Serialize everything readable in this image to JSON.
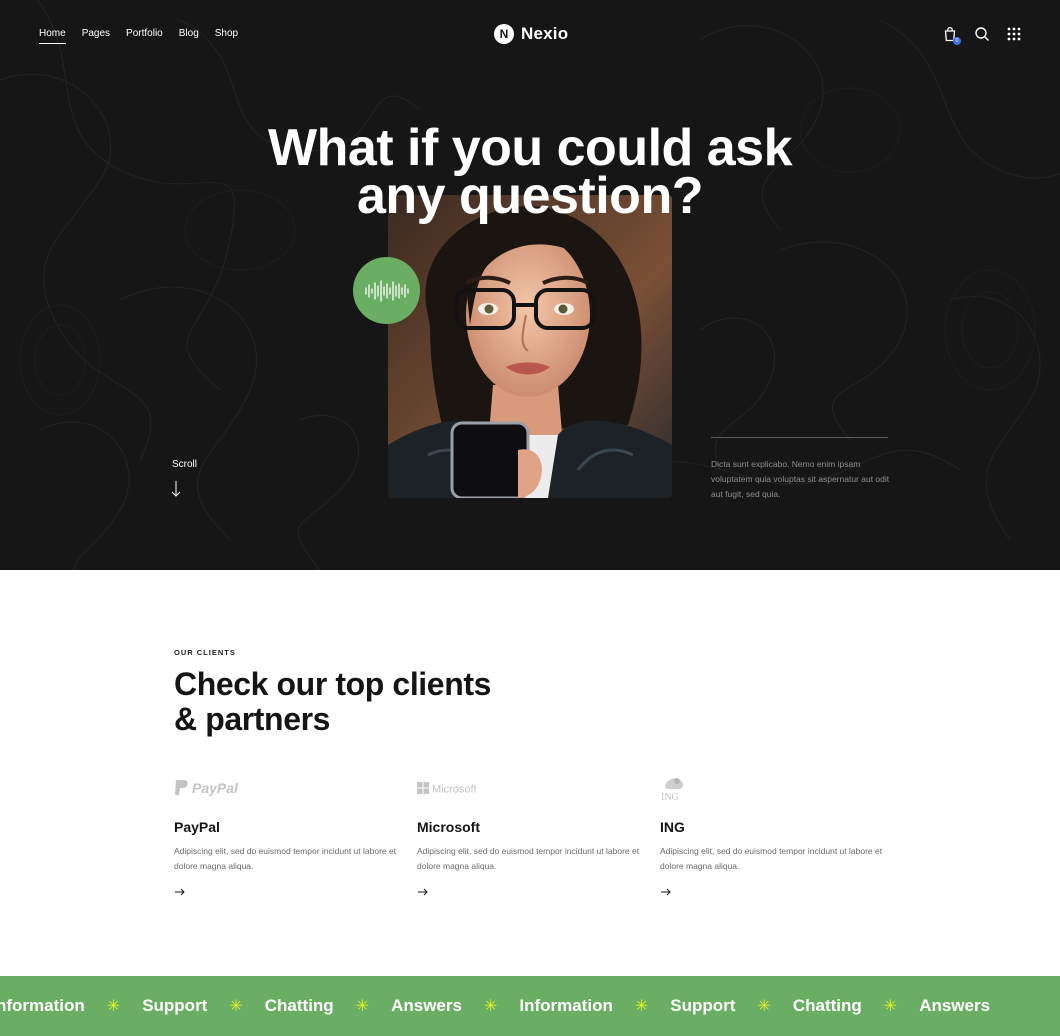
{
  "nav": {
    "items": [
      "Home",
      "Pages",
      "Portfolio",
      "Blog",
      "Shop"
    ]
  },
  "brand": {
    "mark": "N",
    "name": "Nexio"
  },
  "header_icons": {
    "cart": "shopping-bag-icon",
    "search": "search-icon",
    "menu": "grid-menu-icon",
    "cart_count": "0"
  },
  "hero": {
    "headline_line1": "What if you could ask",
    "headline_line2": "any question?",
    "scroll_label": "Scroll",
    "side_text": "Dicta sunt explicabo. Nemo enim ipsam voluptatem quia voluptas sit aspernatur aut odit aut fugit, sed quia.",
    "audio_icon": "audio-waveform-icon"
  },
  "clients": {
    "eyebrow": "OUR CLIENTS",
    "title_line1": "Check our top clients",
    "title_line2": "& partners",
    "items": [
      {
        "logo": "PayPal",
        "name": "PayPal",
        "desc": "Adipiscing elit, sed do euismod tempor incidunt ut labore et dolore magna aliqua."
      },
      {
        "logo": "Microsoft",
        "name": "Microsoft",
        "desc": "Adipiscing elit, sed do euismod tempor incidunt ut labore et dolore magna aliqua."
      },
      {
        "logo": "ING",
        "name": "ING",
        "desc": "Adipiscing elit, sed do euismod tempor incidunt ut labore et dolore magna aliqua."
      }
    ]
  },
  "marquee": {
    "words": [
      "nformation",
      "Support",
      "Chatting",
      "Answers",
      "Information",
      "Support",
      "Chatting",
      "Answers"
    ]
  },
  "colors": {
    "hero_bg": "#161616",
    "accent_green": "#6aae63",
    "star_yellow": "#e3f226",
    "badge_blue": "#3a6ff7"
  }
}
